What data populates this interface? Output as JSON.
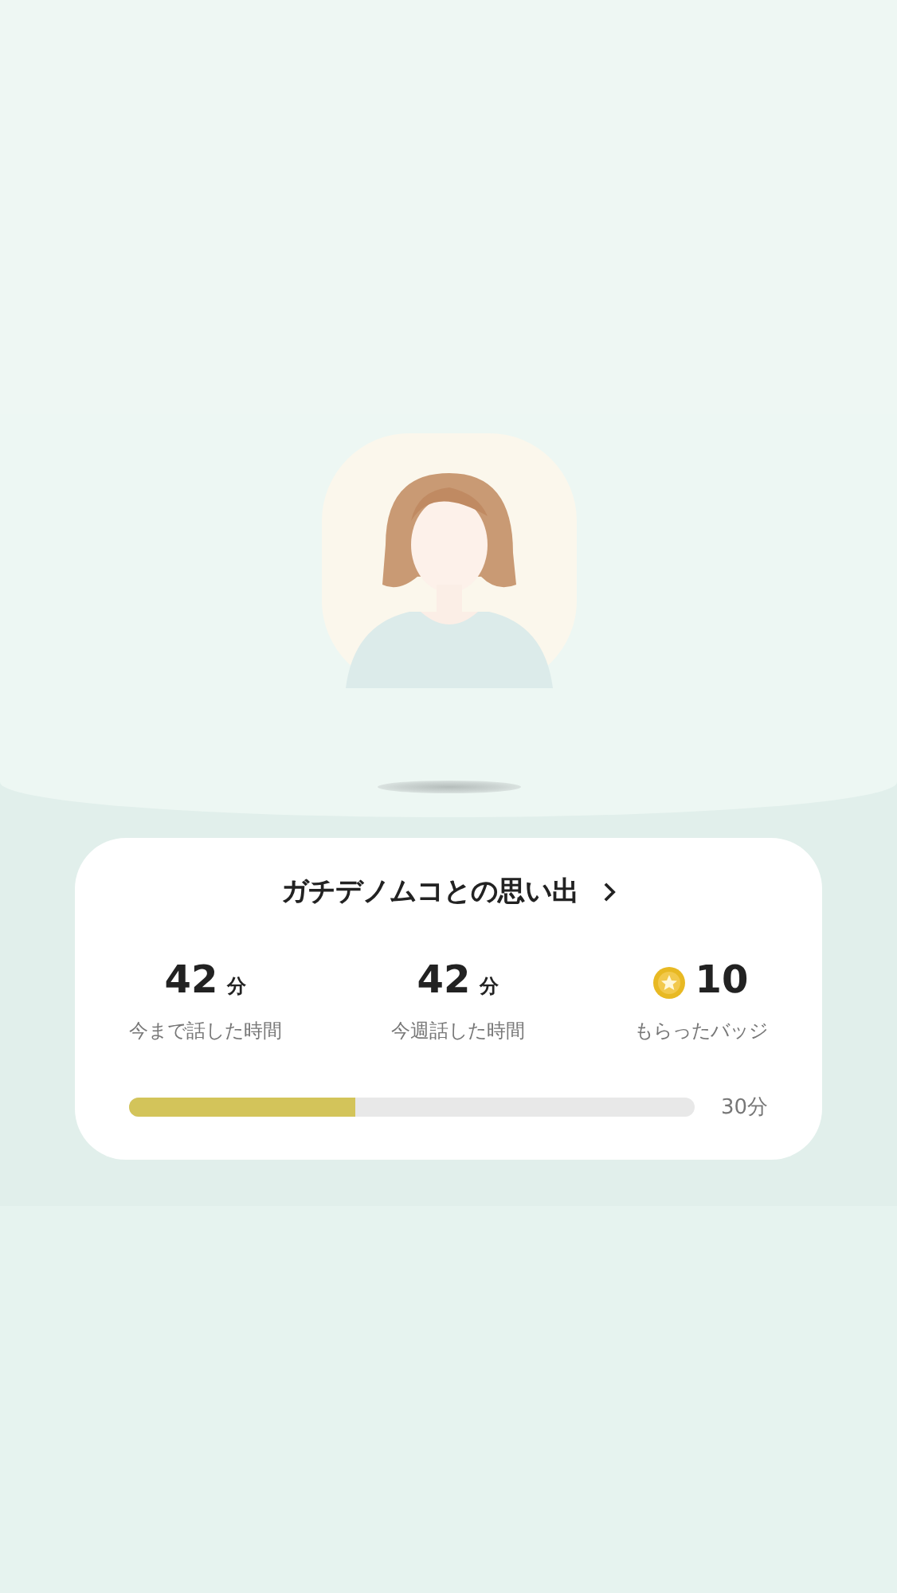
{
  "card": {
    "title": "ガチデノムコとの思い出"
  },
  "stats": [
    {
      "kind": "time",
      "value": "42",
      "unit": "分",
      "label": "今まで話した時間"
    },
    {
      "kind": "time",
      "value": "42",
      "unit": "分",
      "label": "今週話した時間"
    },
    {
      "kind": "badge",
      "value": "10",
      "label": "もらったバッジ"
    }
  ],
  "progress": {
    "level": 0.4,
    "goal": "30分"
  }
}
